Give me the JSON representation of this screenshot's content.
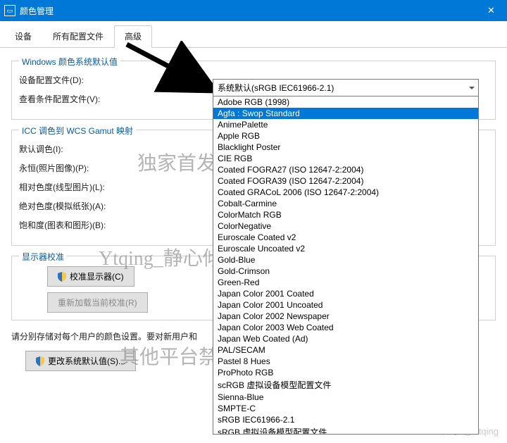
{
  "window": {
    "title": "颜色管理",
    "close_glyph": "✕"
  },
  "tabs": {
    "device": "设备",
    "allProfiles": "所有配置文件",
    "advanced": "高级"
  },
  "group_defaults": {
    "legend": "Windows 颜色系统默认值",
    "device_profile": "设备配置文件(D):",
    "viewing_profile": "查看条件配置文件(V):"
  },
  "group_icc": {
    "legend": "ICC 调色到 WCS Gamut 映射",
    "default_render": "默认调色(I):",
    "perceptual": "永恒(照片图像)(P):",
    "rel_colorimetric": "相对色度(线型图片)(L):",
    "abs_colorimetric": "绝对色度(模拟纸张)(A):",
    "saturation": "饱和度(图表和图形)(B):"
  },
  "group_calibrate": {
    "legend": "显示器校准",
    "btn_calibrate": "校准显示器(C)",
    "btn_reload": "重新加载当前校准(R)"
  },
  "note": "请分别存储对每个用户的颜色设置。要对新用户和",
  "btn_change_defaults": "更改系统默认值(S)...",
  "combo": {
    "selected": "系统默认(sRGB IEC61966-2.1)",
    "options": [
      "Adobe RGB (1998)",
      "Agfa : Swop Standard",
      "AnimePalette",
      "Apple RGB",
      "Blacklight Poster",
      "CIE RGB",
      "Coated FOGRA27 (ISO 12647-2:2004)",
      "Coated FOGRA39 (ISO 12647-2:2004)",
      "Coated GRACoL 2006 (ISO 12647-2:2004)",
      "Cobalt-Carmine",
      "ColorMatch RGB",
      "ColorNegative",
      "Euroscale Coated v2",
      "Euroscale Uncoated v2",
      "Gold-Blue",
      "Gold-Crimson",
      "Green-Red",
      "Japan Color 2001 Coated",
      "Japan Color 2001 Uncoated",
      "Japan Color 2002 Newspaper",
      "Japan Color 2003 Web Coated",
      "Japan Web Coated (Ad)",
      "PAL/SECAM",
      "Pastel 8 Hues",
      "ProPhoto RGB",
      "scRGB 虚拟设备模型配置文件",
      "Sienna-Blue",
      "SMPTE-C",
      "sRGB IEC61966-2.1",
      "sRGB 虚拟设备模型配置文件"
    ],
    "selected_index": 1
  },
  "watermarks": {
    "wm1": "独家首发@知乎",
    "wm2": "Ytqing_静心倾听音乐",
    "wm3": "其他平台禁止转载",
    "corner": "知乎 @Ytqing"
  }
}
